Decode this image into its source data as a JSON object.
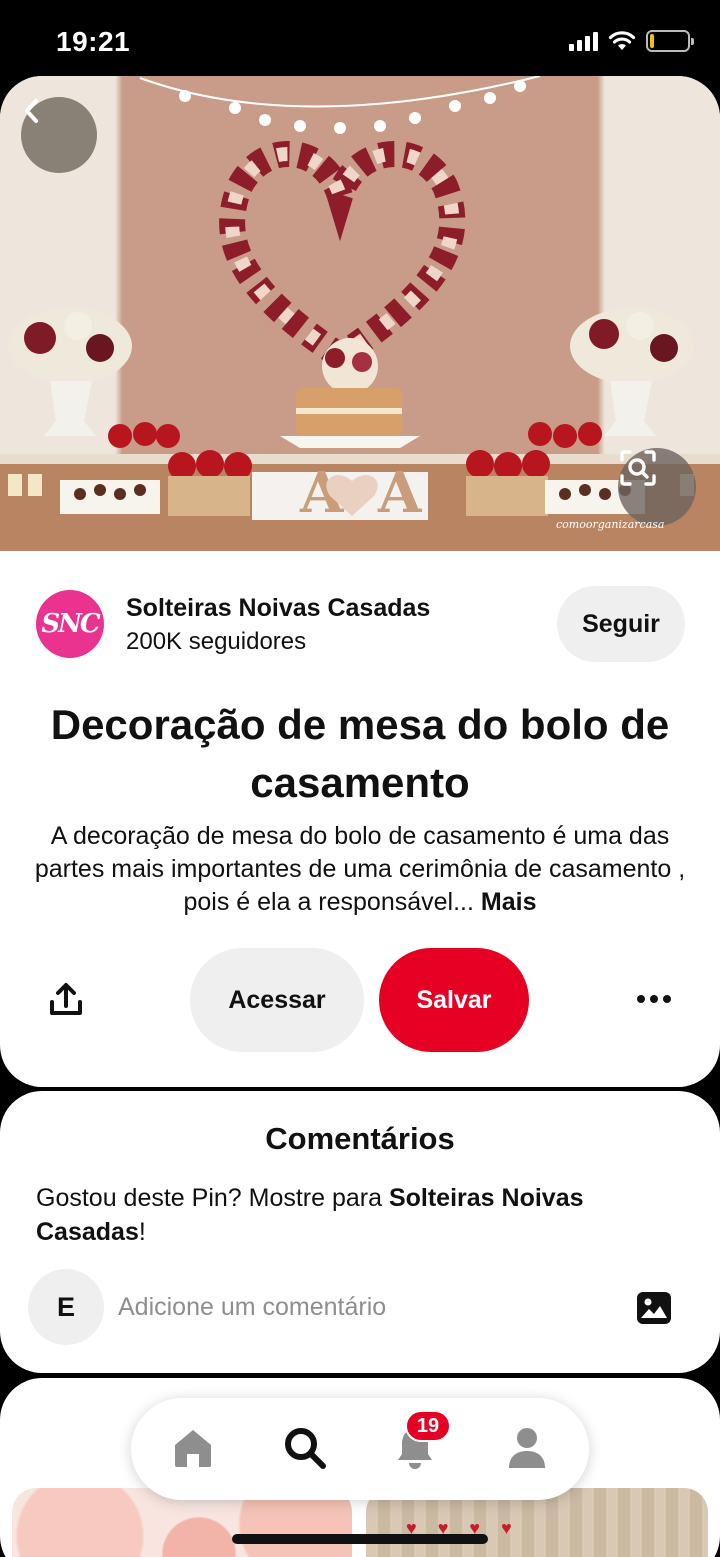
{
  "status_bar": {
    "time": "19:21"
  },
  "pin": {
    "watermark": "comoorganizarcasa",
    "creator": {
      "avatar_initials": "SNC",
      "name": "Solteiras Noivas Casadas",
      "followers": "200K seguidores",
      "follow_label": "Seguir"
    },
    "title": "Decoração de mesa do bolo de casamento",
    "description": "A decoração de mesa do bolo de casamento é uma das partes mais importantes de uma cerimônia de casamento , pois é ela a responsável...",
    "more_label": "Mais",
    "actions": {
      "visit_label": "Acessar",
      "save_label": "Salvar"
    },
    "icons": {
      "back": "back-chevron-icon",
      "lens": "visual-search-icon",
      "share": "share-icon",
      "more": "more-dots-icon"
    }
  },
  "comments": {
    "title": "Comentários",
    "prompt_prefix": "Gostou deste Pin? Mostre para ",
    "prompt_creator": "Solteiras Noivas Casadas",
    "prompt_suffix": "!",
    "user_initial": "E",
    "input_placeholder": "Adicione um comentário"
  },
  "nav": {
    "items": [
      "home-icon",
      "search-icon",
      "notifications-icon",
      "profile-icon"
    ],
    "notification_count": "19"
  },
  "colors": {
    "accent": "#e60023",
    "avatar": "#e9338f",
    "button_gray": "#efefef"
  }
}
